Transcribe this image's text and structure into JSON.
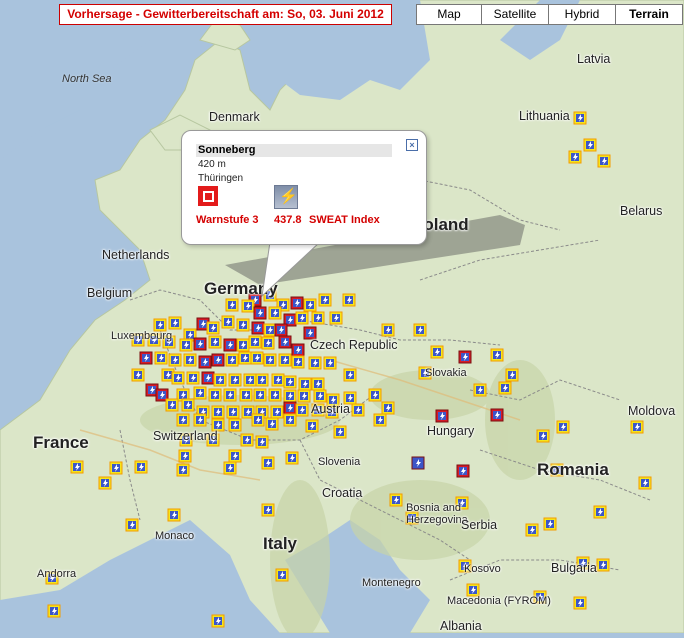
{
  "title": "Vorhersage - Gewitterbereitschaft am: So, 03. Juni 2012",
  "map_types": [
    {
      "label": "Map",
      "active": false
    },
    {
      "label": "Satellite",
      "active": false
    },
    {
      "label": "Hybrid",
      "active": false
    },
    {
      "label": "Terrain",
      "active": true
    }
  ],
  "labels": {
    "north_sea": "North Sea",
    "latvia": "Latvia",
    "denmark": "Denmark",
    "lithuania": "Lithuania",
    "belarus": "Belarus",
    "netherlands": "Netherlands",
    "belgium": "Belgium",
    "germany": "Germany",
    "poland": "Poland",
    "luxembourg": "Luxembourg",
    "czech": "Czech Republic",
    "slovakia": "Slovakia",
    "moldova": "Moldova",
    "france": "France",
    "switzerland": "Switzerland",
    "austria": "Austria",
    "hungary": "Hungary",
    "romania": "Romania",
    "slovenia": "Slovenia",
    "croatia": "Croatia",
    "bosnia": "Bosnia and\nHerzegovina",
    "serbia": "Serbia",
    "monaco": "Monaco",
    "italy": "Italy",
    "kosovo": "Kosovo",
    "bulgaria": "Bulgaria",
    "montenegro": "Montenegro",
    "andorra": "Andorra",
    "macedonia": "Macedonia (FYROM)",
    "albania": "Albania"
  },
  "popup": {
    "station": "Sonneberg",
    "elevation": "420 m",
    "region": "Thüringen",
    "warnstufe": "Warnstufe 3",
    "sweat_value": "437.8",
    "sweat_label": "SWEAT Index",
    "close_icon": "close-icon",
    "warn_icon": "warning-level-icon",
    "sweat_icon": "lightning-icon"
  },
  "markers": {
    "legend_note": "thunderstorm forecast markers",
    "colors": {
      "yellow": "#f4e61c",
      "red": "#d71a27",
      "blue": "#3c56c8",
      "orange": "#f39c00"
    }
  }
}
